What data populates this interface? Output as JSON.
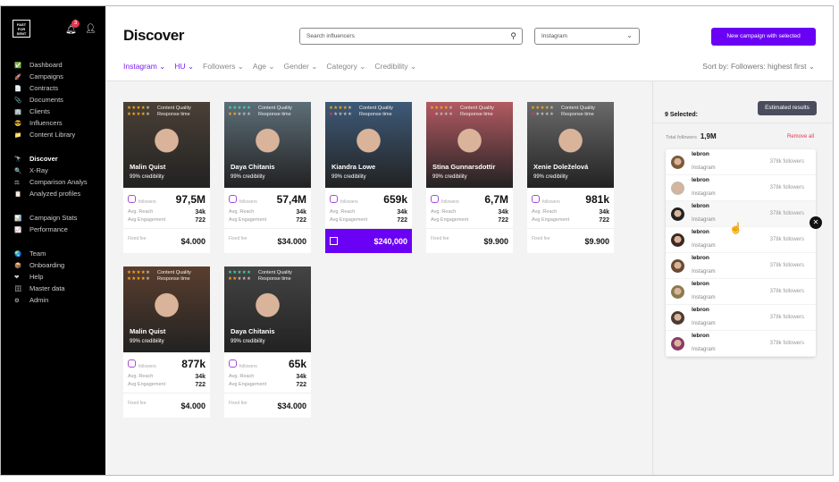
{
  "sidebar": {
    "logo": "FAST FOR SENT",
    "notifications": "3",
    "groups": [
      [
        {
          "label": "Dashboard",
          "icon": "✅"
        },
        {
          "label": "Campaigns",
          "icon": "🚀"
        },
        {
          "label": "Contracts",
          "icon": "📄"
        },
        {
          "label": "Documents",
          "icon": "📎"
        },
        {
          "label": "Clients",
          "icon": "🏢"
        },
        {
          "label": "Influencers",
          "icon": "😎"
        },
        {
          "label": "Content Library",
          "icon": "📁"
        }
      ],
      [
        {
          "label": "Discover",
          "icon": "🔭",
          "active": true
        },
        {
          "label": "X-Ray",
          "icon": "🔍"
        },
        {
          "label": "Comparison Analys",
          "icon": "⚖"
        },
        {
          "label": "Analyzed profiles",
          "icon": "📋"
        }
      ],
      [
        {
          "label": "Campaign Stats",
          "icon": "📊"
        },
        {
          "label": "Performance",
          "icon": "📈"
        }
      ],
      [
        {
          "label": "Team",
          "icon": "🌏"
        },
        {
          "label": "Onboarding",
          "icon": "📦"
        },
        {
          "label": "Help",
          "icon": "❤"
        },
        {
          "label": "Master data",
          "icon": "🗄"
        },
        {
          "label": "Admin",
          "icon": "⚙"
        }
      ]
    ]
  },
  "header": {
    "title": "Discover",
    "search_placeholder": "Search influencers",
    "platform": "Instagram",
    "new_campaign": "New campaign with selected",
    "filters": [
      {
        "label": "Instagram",
        "on": true
      },
      {
        "label": "HU",
        "on": true
      },
      {
        "label": "Followers"
      },
      {
        "label": "Age"
      },
      {
        "label": "Gender"
      },
      {
        "label": "Category"
      },
      {
        "label": "Credibility"
      }
    ],
    "sort": "Sort by: Followers: highest first"
  },
  "card_labels": {
    "content_quality": "Content Quality",
    "response_time": "Response time",
    "followers": "followers",
    "avg_reach": "Avg. Reach",
    "avg_engagement": "Avg Engagement",
    "fixed_fee": "Fixed fee"
  },
  "cards": [
    {
      "name": "Malin Quist",
      "credibility": "99% credibility",
      "followers": "97,5M",
      "reach": "34k",
      "engagement": "722",
      "fee": "$4.000",
      "cq": 4,
      "rt": 4,
      "bg": "#4a4036"
    },
    {
      "name": "Daya Chitanis",
      "credibility": "99% credibility",
      "followers": "57,4M",
      "reach": "34k",
      "engagement": "722",
      "fee": "$34.000",
      "cq": 5,
      "rt": 2,
      "bg": "#5d6e78"
    },
    {
      "name": "Kiandra Lowe",
      "credibility": "99% credibility",
      "followers": "659k",
      "reach": "34k",
      "engagement": "722",
      "fee": "$240,000",
      "cq": 4,
      "rt": 1,
      "bg": "#3e5a78",
      "selected": true
    },
    {
      "name": "Stina Gunnarsdottir",
      "credibility": "99% credibility",
      "followers": "6,7M",
      "reach": "34k",
      "engagement": "722",
      "fee": "$9.900",
      "cq": 4,
      "rt": 1,
      "bg": "#b35a62"
    },
    {
      "name": "Xenie Doleželová",
      "credibility": "99% credibility",
      "followers": "981k",
      "reach": "34k",
      "engagement": "722",
      "fee": "$9.900",
      "cq": 4,
      "rt": 1,
      "bg": "#6a6a6a"
    },
    {
      "name": "Malin Quist",
      "credibility": "99% credibility",
      "followers": "877k",
      "reach": "34k",
      "engagement": "722",
      "fee": "$4.000",
      "cq": 4,
      "rt": 4,
      "bg": "#5a3e2e"
    },
    {
      "name": "Daya Chitanis",
      "credibility": "99% credibility",
      "followers": "65k",
      "reach": "34k",
      "engagement": "722",
      "fee": "$34.000",
      "cq": 5,
      "rt": 2,
      "bg": "#444"
    }
  ],
  "panel": {
    "estimated": "Estimated results",
    "selected": "9 Selected:",
    "total_label": "Total followers",
    "total": "1,9M",
    "remove_all": "Remove all",
    "items": [
      {
        "name": "lebron",
        "platform": "Instagram",
        "followers": "378k followers",
        "c": "#7a5a3a"
      },
      {
        "name": "lebron",
        "platform": "Instagram",
        "followers": "378k followers",
        "c": "#c8b8a8"
      },
      {
        "name": "lebron",
        "platform": "Instagram",
        "followers": "378k followers",
        "c": "#222"
      },
      {
        "name": "lebron",
        "platform": "Instagram",
        "followers": "378k followers",
        "c": "#3a2a20"
      },
      {
        "name": "lebron",
        "platform": "Instagram",
        "followers": "378k followers",
        "c": "#6a4a30"
      },
      {
        "name": "lebron",
        "platform": "Instagram",
        "followers": "378k followers",
        "c": "#8a7a50"
      },
      {
        "name": "lebron",
        "platform": "Instagram",
        "followers": "378k followers",
        "c": "#4a3a30"
      },
      {
        "name": "lebron",
        "platform": "Instagram",
        "followers": "378k followers",
        "c": "#8a3a6a"
      }
    ]
  }
}
